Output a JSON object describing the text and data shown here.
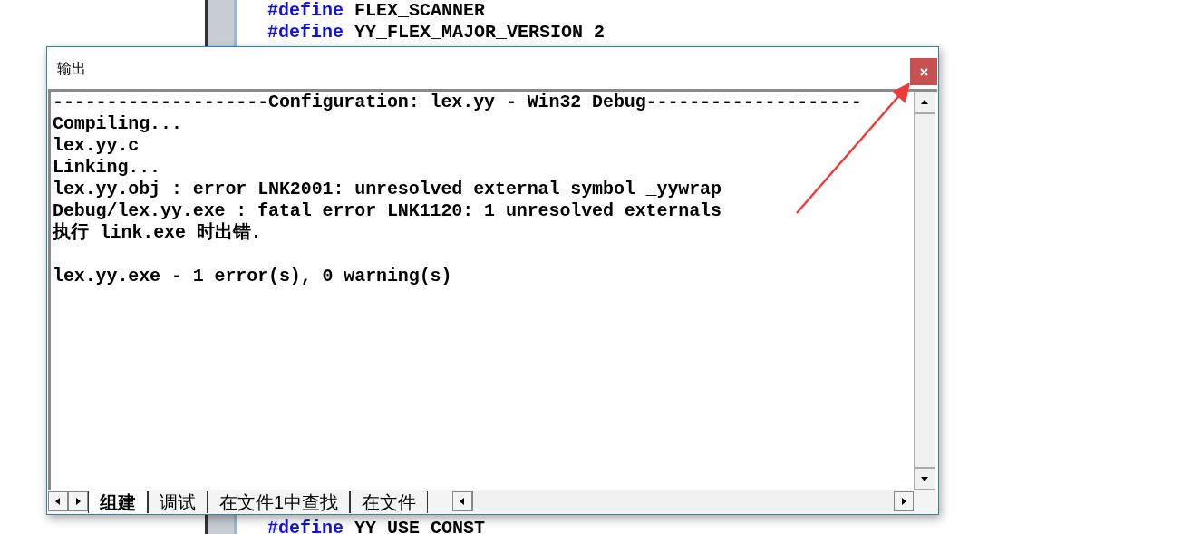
{
  "editor": {
    "lines_top": [
      {
        "keyword": "#define",
        "text": "FLEX_SCANNER"
      },
      {
        "keyword": "#define",
        "text": "YY_FLEX_MAJOR_VERSION 2"
      }
    ],
    "lines_bottom": [
      {
        "keyword": "#define",
        "text": "YY_USE_CONST"
      }
    ]
  },
  "output_window": {
    "title": "输出",
    "line_groups": [
      [
        "--------------------Configuration: lex.yy - Win32 Debug--------------------",
        "Compiling...",
        "lex.yy.c",
        "Linking...",
        "lex.yy.obj : error LNK2001: unresolved external symbol _yywrap",
        "Debug/lex.yy.exe : fatal error LNK1120: 1 unresolved externals",
        "执行 link.exe 时出错."
      ],
      [
        "lex.yy.exe - 1 error(s), 0 warning(s)"
      ]
    ],
    "tabs": [
      {
        "label": "组建",
        "selected": true
      },
      {
        "label": "调试",
        "selected": false
      },
      {
        "label": "在文件1中查找",
        "selected": false
      },
      {
        "label": "在文件",
        "selected": false
      }
    ]
  }
}
